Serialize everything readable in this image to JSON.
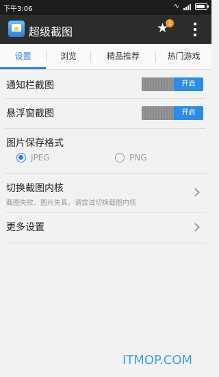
{
  "status": {
    "time": "下午3:06"
  },
  "app": {
    "title": "超级截图",
    "badge_count": "1",
    "icons": [
      "app-logo",
      "star-icon",
      "overflow-menu-icon"
    ]
  },
  "tabs": [
    {
      "label": "设置",
      "active": true
    },
    {
      "label": "浏览",
      "active": false
    },
    {
      "label": "精品推荐",
      "active": false
    },
    {
      "label": "热门游戏",
      "active": false
    }
  ],
  "settings": {
    "notification_capture": {
      "label": "通知栏截图",
      "toggle_label": "开启",
      "enabled": true
    },
    "floating_capture": {
      "label": "悬浮窗截图",
      "toggle_label": "开启",
      "enabled": true
    },
    "image_format": {
      "label": "图片保存格式",
      "options": [
        {
          "label": "JPEG",
          "selected": true
        },
        {
          "label": "PNG",
          "selected": false
        }
      ]
    },
    "switch_core": {
      "label": "切换截图内核",
      "hint": "截图失败、图片失真，请尝试切换截图内核"
    },
    "more_settings": {
      "label": "更多设置"
    }
  },
  "watermark": "ITMOP.COM",
  "colors": {
    "accent": "#2a82e4",
    "toggle_on": "#2b8be6",
    "badge": "#f39a2b",
    "app_bar": "#2c2c2c"
  }
}
